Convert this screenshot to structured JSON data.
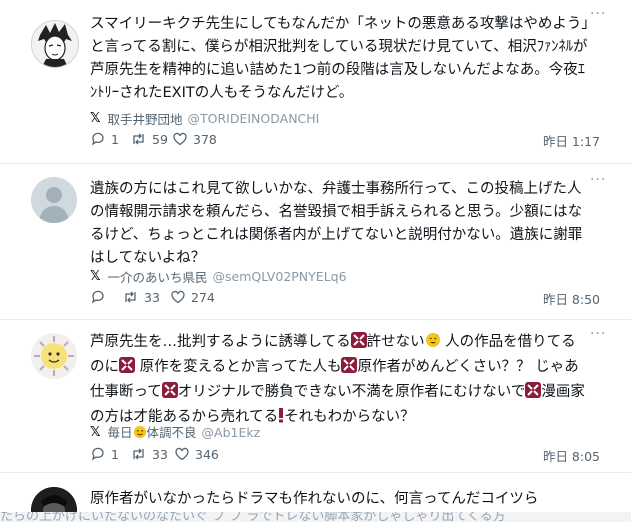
{
  "posts": [
    {
      "text": "スマイリーキクチ先生にしてもなんだか「ネットの悪意ある攻撃はやめよう」と言ってる割に、僕らが相沢批判をしている現状だけ見ていて、相沢ﾌｧﾝﾈﾙが芦原先生を精神的に追い詰めた1つ前の段階は言及しないんだよなあ。今夜ｴﾝﾄﾘｰされたEXITの人もそうなんだけど。",
      "source_name": "取手井野団地",
      "source_handle": "@TORIDEINODANCHI",
      "replies": "1",
      "reposts": "59",
      "likes": "378",
      "time": "昨日 1:17"
    },
    {
      "text": "遺族の方にはこれ見て欲しいかな、弁護士事務所行って、この投稿上げた人の情報開示請求を頼んだら、名誉毀損で相手訴えられると思う。少額にはなるけど、ちょっとこれは関係者内が上げてないと説明付かない。遺族に謝罪はしてないよね？",
      "source_name": "一介のあいち県民",
      "source_handle": "@semQLV02PNYELq6",
      "replies": "",
      "reposts": "33",
      "likes": "274",
      "time": "昨日 8:50"
    },
    {
      "text_parts": [
        "芦原先生を…批判するように誘導してる",
        "許せない",
        " 人の作品を借りてるのに",
        " 原作を変えるとか言ってた人も",
        "原作者がめんどくさい？？ じゃあ仕事断って",
        "オリジナルで勝負できない不満を原作者にむけないで",
        "漫画家の方は才能あるから売れてる",
        "それもわからない？"
      ],
      "source_name_pre": "毎日",
      "source_name_post": "体調不良",
      "source_handle": "@Ab1Ekz",
      "replies": "1",
      "reposts": "33",
      "likes": "346",
      "time": "昨日 8:05"
    },
    {
      "text": "原作者がいなかったらドラマも作れないのに、何言ってんだコイツら"
    }
  ],
  "bottom_text": "たらの上がげにいたないのなたいぐ ブ ブ ラでトレない脚本家がしゃしゃり出てくる方",
  "icons": {
    "brand": "x-logo-icon",
    "reply": "reply-bubble-icon",
    "repost": "repost-icon",
    "like": "heart-icon",
    "more": "more-dots-icon",
    "anger": "anger-symbol-emoji",
    "face": "smiling-sweat-emoji"
  },
  "colors": {
    "text": "#0f1419",
    "secondary": "#536471",
    "divider": "#e6ecf0",
    "anger_emoji": "#8b1c3a",
    "face_emoji": "#f5c518"
  }
}
